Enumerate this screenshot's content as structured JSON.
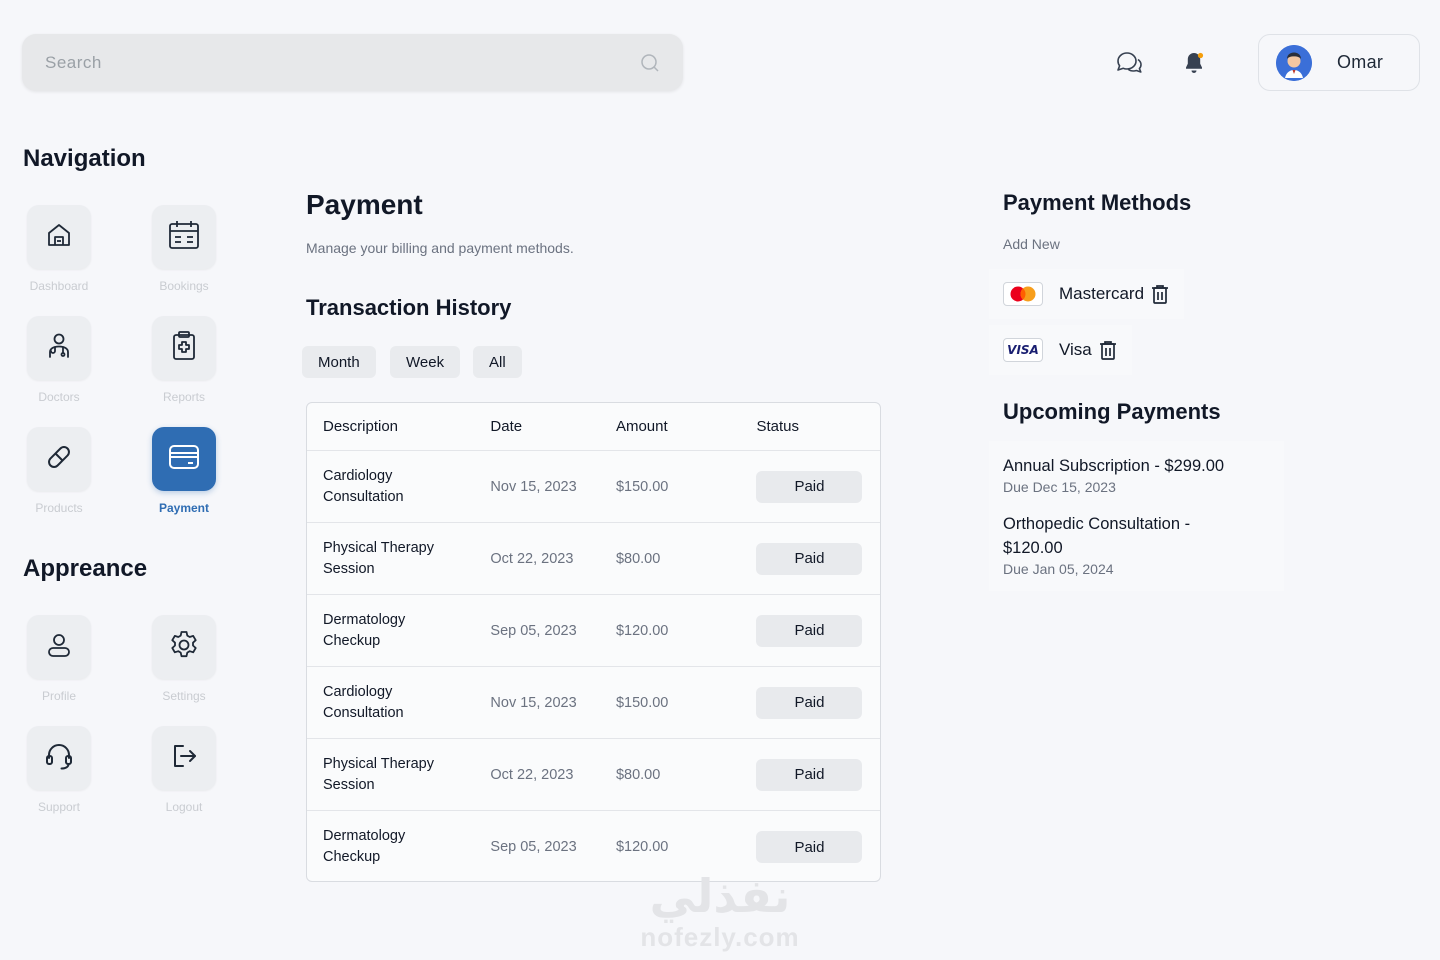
{
  "search": {
    "placeholder": "Search"
  },
  "user": {
    "name": "Omar"
  },
  "sidebar": {
    "navigation_title": "Navigation",
    "appearance_title": "Appreance",
    "nav": [
      {
        "label": "Dashboard",
        "icon": "home-icon"
      },
      {
        "label": "Bookings",
        "icon": "calendar-icon"
      },
      {
        "label": "Doctors",
        "icon": "doctor-icon"
      },
      {
        "label": "Reports",
        "icon": "clipboard-icon"
      },
      {
        "label": "Products",
        "icon": "pill-icon"
      },
      {
        "label": "Payment",
        "icon": "wallet-icon",
        "active": true
      }
    ],
    "appearance": [
      {
        "label": "Profile",
        "icon": "user-icon"
      },
      {
        "label": "Settings",
        "icon": "gear-icon"
      },
      {
        "label": "Support",
        "icon": "headset-icon"
      },
      {
        "label": "Logout",
        "icon": "logout-icon"
      }
    ]
  },
  "main": {
    "title": "Payment",
    "subtitle": "Manage your billing and payment methods.",
    "history_title": "Transaction History",
    "filters": [
      "Month",
      "Week",
      "All"
    ],
    "table": {
      "headers": [
        "Description",
        "Date",
        "Amount",
        "Status"
      ],
      "rows": [
        {
          "desc_line1": "Cardiology",
          "desc_line2": "Consultation",
          "date": "Nov 15, 2023",
          "amount": "$150.00",
          "status": "Paid"
        },
        {
          "desc_line1": "Physical Therapy",
          "desc_line2": "Session",
          "date": "Oct 22, 2023",
          "amount": "$80.00",
          "status": "Paid"
        },
        {
          "desc_line1": "Dermatology",
          "desc_line2": "Checkup",
          "date": "Sep 05, 2023",
          "amount": "$120.00",
          "status": "Paid"
        },
        {
          "desc_line1": "Cardiology",
          "desc_line2": "Consultation",
          "date": "Nov 15, 2023",
          "amount": "$150.00",
          "status": "Paid"
        },
        {
          "desc_line1": "Physical Therapy",
          "desc_line2": "Session",
          "date": "Oct 22, 2023",
          "amount": "$80.00",
          "status": "Paid"
        },
        {
          "desc_line1": "Dermatology",
          "desc_line2": "Checkup",
          "date": "Sep 05, 2023",
          "amount": "$120.00",
          "status": "Paid"
        }
      ]
    }
  },
  "right": {
    "methods_title": "Payment Methods",
    "add_new": "Add New",
    "methods": [
      {
        "label": "Mastercard",
        "icon": "mastercard-icon"
      },
      {
        "label": "Visa",
        "icon": "visa-icon",
        "badge_text": "VISA"
      }
    ],
    "upcoming_title": "Upcoming Payments",
    "upcoming": [
      {
        "title": "Annual Subscription - $299.00",
        "due": "Due Dec 15, 2023"
      },
      {
        "title_line1": "Orthopedic Consultation -",
        "title_line2": "$120.00",
        "due": "Due Jan 05, 2024"
      }
    ]
  },
  "watermark": {
    "arabic": "نفذلي",
    "latin": "nofezly.com"
  },
  "colors": {
    "accent": "#2f6db3",
    "background": "#f6f7fa",
    "tile": "#eceef1",
    "muted_label": "#c9ccd1"
  }
}
